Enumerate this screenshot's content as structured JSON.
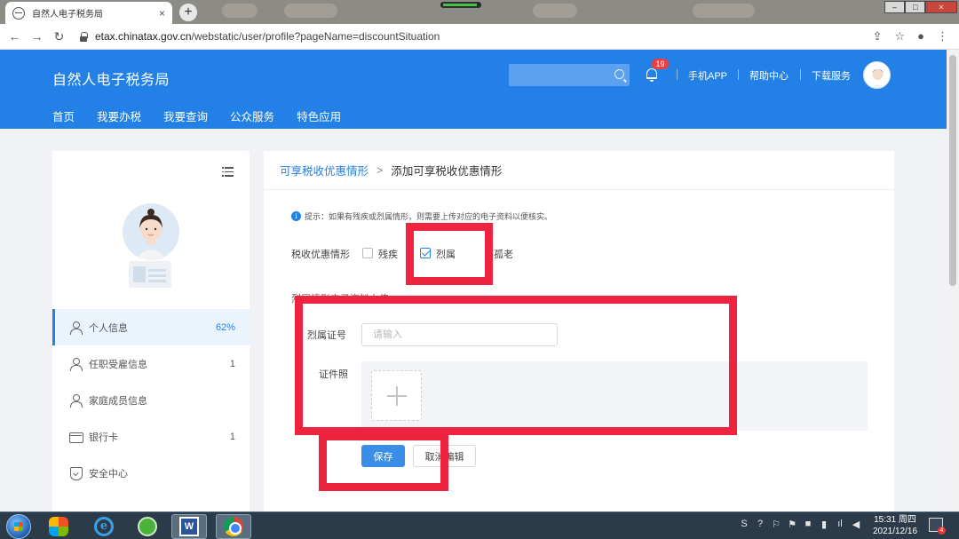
{
  "browser": {
    "tab_title": "自然人电子税务局",
    "tab_close": "×",
    "new_tab": "+",
    "url_host": "etax.chinatax.gov.cn",
    "url_path": "/webstatic/user/profile?pageName=discountSituation",
    "nav_back": "←",
    "nav_forward": "→",
    "nav_reload": "↻",
    "icon_share": "⇪",
    "icon_star": "☆",
    "icon_profile": "●",
    "icon_menu": "⋮",
    "window_min": "–",
    "window_max": "□",
    "window_close": "×"
  },
  "header": {
    "site_title": "自然人电子税务局",
    "notification_count": "19",
    "links": [
      "手机APP",
      "帮助中心",
      "下载服务"
    ],
    "nav": [
      "首页",
      "我要办税",
      "我要查询",
      "公众服务",
      "特色应用"
    ]
  },
  "sidebar": {
    "items": [
      {
        "label": "个人信息",
        "value": "62%",
        "icon": "person-icon",
        "active": true
      },
      {
        "label": "任职受雇信息",
        "value": "1",
        "icon": "person-icon"
      },
      {
        "label": "家庭成员信息",
        "value": "",
        "icon": "person-icon"
      },
      {
        "label": "银行卡",
        "value": "1",
        "icon": "card-icon"
      },
      {
        "label": "安全中心",
        "value": "",
        "icon": "shield-icon"
      }
    ]
  },
  "content": {
    "breadcrumb_parent": "可享税收优惠情形",
    "breadcrumb_sep": ">",
    "breadcrumb_current": "添加可享税收优惠情形",
    "hint_icon": "i",
    "hint": "提示：如果有残疾或烈属情形，则需要上传对应的电子资料以便核实。",
    "discount_label": "税收优惠情形",
    "options": [
      {
        "label": "残疾",
        "checked": false
      },
      {
        "label": "烈属",
        "checked": true
      },
      {
        "label": "孤老",
        "checked": false
      }
    ],
    "section_title": "烈属情形电子资料上传",
    "cert_label": "烈属证号",
    "cert_placeholder": "请输入",
    "photo_label": "证件照",
    "save_label": "保存",
    "cancel_label": "取消编辑"
  },
  "taskbar": {
    "ie_glyph": "e",
    "word_glyph": "W",
    "notif_count": "4",
    "tray_icons": [
      "S",
      "?",
      "⚐",
      "⚑",
      "■",
      "▮",
      "ıl",
      "◀"
    ],
    "time": "15:31 周四",
    "date": "2021/12/16"
  },
  "colors": {
    "brand_blue": "#2380e6",
    "annotation_red": "#ec2440"
  }
}
